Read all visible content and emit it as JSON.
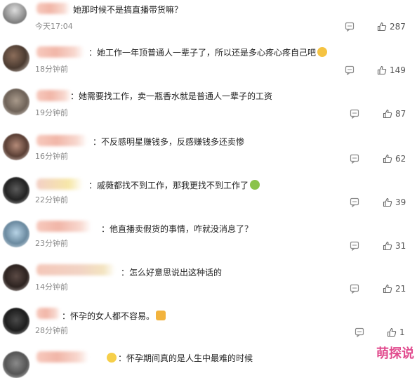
{
  "comments": [
    {
      "text": "她那时候不是搞直播带货嘛？",
      "time": "今天17:04",
      "likes": "287"
    },
    {
      "text": "她工作一年顶普通人一辈子了，所以还是多心疼心疼自己吧",
      "time": "18分钟前",
      "likes": "149"
    },
    {
      "text": "她需要找工作，卖一瓶香水就是普通人一辈子的工资",
      "time": "19分钟前",
      "likes": "87"
    },
    {
      "text": "不反感明星赚钱多，反感赚钱多还卖惨",
      "time": "16分钟前",
      "likes": "62"
    },
    {
      "text": "戚薇都找不到工作，那我更找不到工作了",
      "time": "22分钟前",
      "likes": "39"
    },
    {
      "text": "他直播卖假货的事情，咋就没消息了？",
      "time": "23分钟前",
      "likes": "31"
    },
    {
      "text": "怎么好意思说出这种话的",
      "time": "14分钟前",
      "likes": "21"
    },
    {
      "text": "怀孕的女人都不容易。",
      "time": "28分钟前",
      "likes": "1"
    },
    {
      "text": "怀孕期间真的是人生中最难的时候",
      "time": "",
      "likes": ""
    }
  ],
  "icons": {
    "reply": "comment-reply-icon",
    "like": "thumb-up-icon"
  },
  "watermark": "萌探说",
  "colors": {
    "accent": "#e14b8e",
    "meta": "#8a8a8a"
  }
}
